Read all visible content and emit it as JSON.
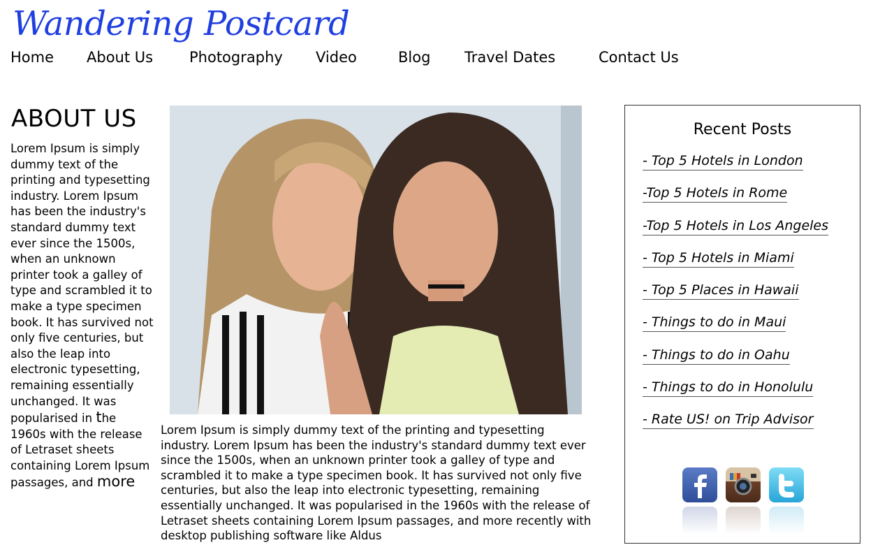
{
  "site": {
    "logo": "Wandering Postcard"
  },
  "nav": {
    "items": [
      {
        "label": "Home"
      },
      {
        "label": "About Us"
      },
      {
        "label": "Photography"
      },
      {
        "label": "Video"
      },
      {
        "label": "Blog"
      },
      {
        "label": "Travel Dates"
      },
      {
        "label": "Contact Us"
      }
    ]
  },
  "about": {
    "title": "ABOUT US",
    "body_main": "Lorem Ipsum is simply dummy text of the printing and typesetting industry. Lorem Ipsum has been the industry's standard dummy text ever since the 1500s, when an unknown printer took a galley of type and scrambled it to make a type specimen book. It has survived not only five centuries, but also the leap into electronic typesetting, remaining essentially unchanged. It was popularised in ",
    "body_big_t": "t",
    "body_mid": "he 1960s with the release of Letraset sheets containing Lorem Ipsum passages, and ",
    "body_big_more": "more"
  },
  "photo": {
    "description": "Lorem Ipsum is simply dummy text of the printing and typesetting industry. Lorem Ipsum has been the industry's standard dummy text ever since the 1500s, when an unknown printer took a galley of type and scrambled it to make a type specimen book. It has survived not only five centuries, but also the leap into electronic typesetting, remaining essentially unchanged. It was popularised in the 1960s with the release of Letraset sheets containing Lorem Ipsum passages, and more recently with desktop publishing software like Aldus"
  },
  "sidebar": {
    "title": "Recent Posts",
    "posts": [
      {
        "label": "- Top 5 Hotels in London"
      },
      {
        "label": "-Top 5 Hotels in Rome"
      },
      {
        "label": "-Top 5 Hotels in Los Angeles"
      },
      {
        "label": "- Top 5 Hotels in Miami"
      },
      {
        "label": "- Top 5 Places in Hawaii"
      },
      {
        "label": "- Things to do in Maui"
      },
      {
        "label": "- Things to do in Oahu"
      },
      {
        "label": "- Things to do in Honolulu"
      },
      {
        "label": "- Rate US! on Trip Advisor"
      }
    ],
    "social": [
      {
        "icon": "facebook-icon",
        "glyph": "f",
        "color": "#3b5ba8"
      },
      {
        "icon": "instagram-icon",
        "glyph": "",
        "color": "#8a5a3a"
      },
      {
        "icon": "twitter-icon",
        "glyph": "t",
        "color": "#2fb6e6"
      }
    ]
  },
  "colors": {
    "logo": "#1f3fe0",
    "text": "#000000",
    "border": "#333333"
  }
}
